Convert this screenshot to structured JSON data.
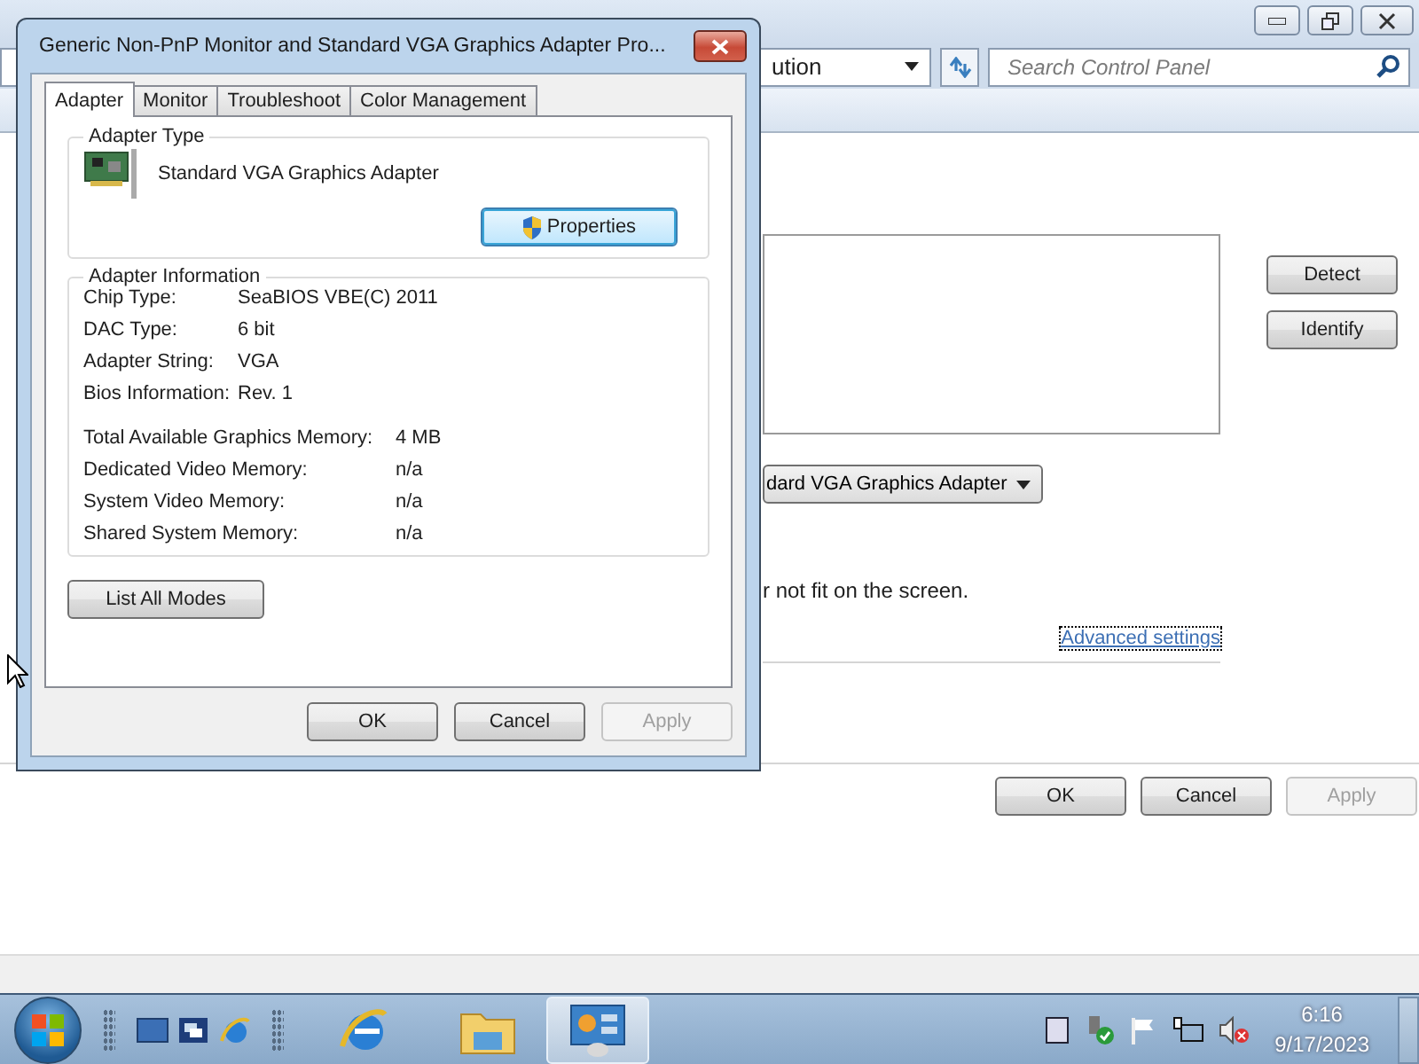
{
  "background_window": {
    "address_bar": {
      "text": "ution"
    },
    "search": {
      "placeholder": "Search Control Panel"
    },
    "display_dropdown": {
      "value": "dard VGA Graphics Adapter"
    },
    "side_buttons": [
      {
        "label": "Detect"
      },
      {
        "label": "Identify"
      }
    ],
    "note": "r not fit on the screen.",
    "link": "Advanced settings",
    "buttons": [
      {
        "label": "OK",
        "disabled": false
      },
      {
        "label": "Cancel",
        "disabled": false
      },
      {
        "label": "Apply",
        "disabled": true
      }
    ]
  },
  "dialog": {
    "title": "Generic Non-PnP Monitor and Standard VGA Graphics Adapter Pro...",
    "tabs": [
      {
        "label": "Adapter",
        "selected": true
      },
      {
        "label": "Monitor",
        "selected": false
      },
      {
        "label": "Troubleshoot",
        "selected": false
      },
      {
        "label": "Color Management",
        "selected": false
      }
    ],
    "adapter_type": {
      "heading": "Adapter Type",
      "name": "Standard VGA Graphics Adapter",
      "button": "Properties"
    },
    "adapter_info": {
      "heading": "Adapter Information",
      "rows": [
        {
          "label": "Chip Type:",
          "value": "SeaBIOS VBE(C) 2011"
        },
        {
          "label": "DAC Type:",
          "value": "6 bit"
        },
        {
          "label": "Adapter String:",
          "value": "VGA"
        },
        {
          "label": "Bios Information:",
          "value": "Rev. 1"
        }
      ],
      "memory_rows": [
        {
          "label": "Total Available Graphics Memory:",
          "value": "4 MB"
        },
        {
          "label": "Dedicated Video Memory:",
          "value": "n/a"
        },
        {
          "label": "System Video Memory:",
          "value": "n/a"
        },
        {
          "label": "Shared System Memory:",
          "value": "n/a"
        }
      ]
    },
    "list_button": "List All Modes",
    "buttons": [
      {
        "label": "OK",
        "disabled": false
      },
      {
        "label": "Cancel",
        "disabled": false
      },
      {
        "label": "Apply",
        "disabled": true
      }
    ]
  },
  "taskbar": {
    "apps": [
      {
        "kind": "browser",
        "selected": false
      },
      {
        "kind": "folder",
        "selected": false
      },
      {
        "kind": "control-panel",
        "selected": true
      }
    ],
    "clock": {
      "time": "6:16",
      "date": "9/17/2023"
    }
  }
}
